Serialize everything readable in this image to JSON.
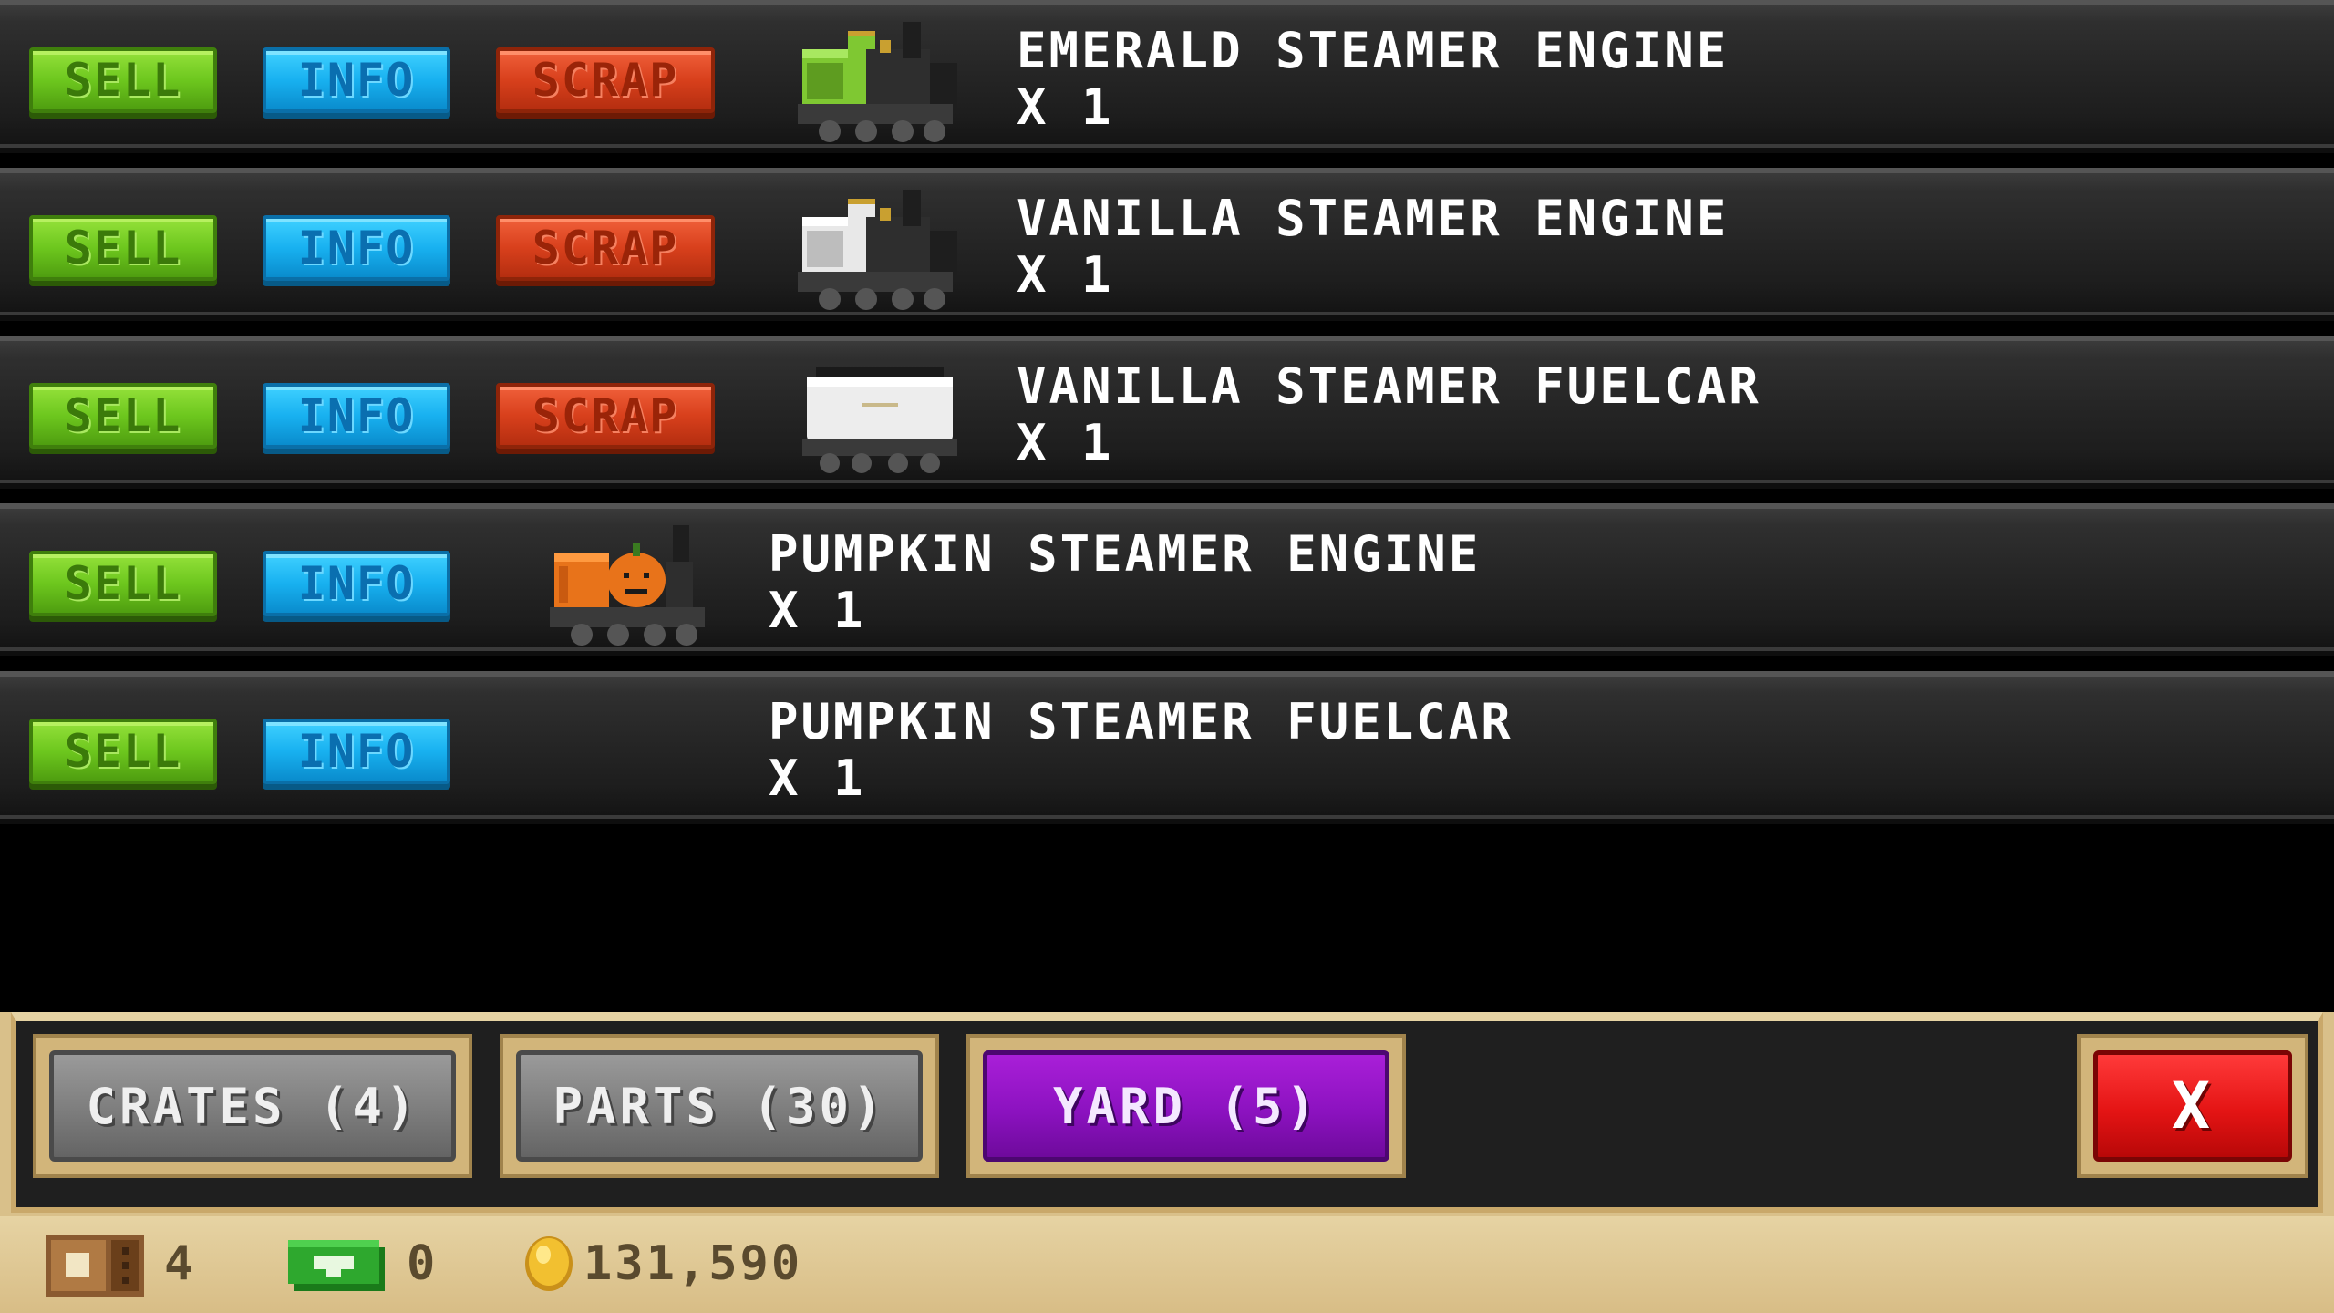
{
  "rows": [
    {
      "sell": "SELL",
      "info": "INFO",
      "scrap": "SCRAP",
      "name": "EMERALD STEAMER ENGINE",
      "qty": "X 1",
      "icon": "emerald-steam-engine-icon",
      "color": "#7fc832"
    },
    {
      "sell": "SELL",
      "info": "INFO",
      "scrap": "SCRAP",
      "name": "VANILLA STEAMER ENGINE",
      "qty": "X 1",
      "icon": "vanilla-steam-engine-icon",
      "color": "#e8e8e8"
    },
    {
      "sell": "SELL",
      "info": "INFO",
      "scrap": "SCRAP",
      "name": "VANILLA STEAMER FUELCAR",
      "qty": "X 1",
      "icon": "vanilla-fuelcar-icon",
      "color": "#e8e8e8"
    },
    {
      "sell": "SELL",
      "info": "INFO",
      "name": "PUMPKIN STEAMER ENGINE",
      "qty": "X 1",
      "icon": "pumpkin-steam-engine-icon",
      "color": "#e8731a"
    },
    {
      "sell": "SELL",
      "info": "INFO",
      "name": "PUMPKIN STEAMER FUELCAR",
      "qty": "X 1",
      "icon": "none",
      "color": ""
    }
  ],
  "tabs": {
    "crates": "CRATES (4)",
    "parts": "PARTS (30)",
    "yard": "YARD (5)",
    "close": "X"
  },
  "status": {
    "crates_count": "4",
    "cash": "0",
    "coins": "131,590"
  },
  "colors": {
    "sell": "#6dc71e",
    "info": "#18b1f0",
    "scrap": "#d8401c",
    "yard_active": "#8c12c0",
    "close": "#e41414",
    "panel": "#d9c08a"
  }
}
